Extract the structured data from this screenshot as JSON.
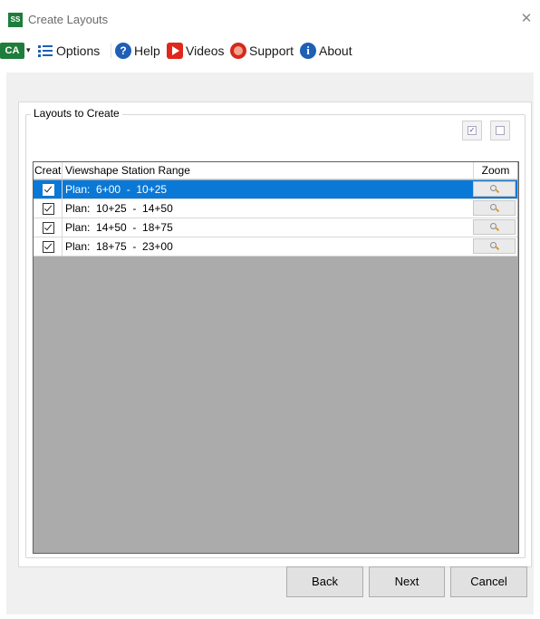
{
  "window": {
    "title": "Create Layouts",
    "app_logo_text": "SS",
    "close_glyph": "✕"
  },
  "toolbar": {
    "logo_text": "CA",
    "caret": "▾",
    "items": [
      {
        "label": "Options",
        "icon": "list-icon"
      },
      {
        "label": "Help",
        "icon": "help-icon"
      },
      {
        "label": "Videos",
        "icon": "video-icon"
      },
      {
        "label": "Support",
        "icon": "support-icon"
      },
      {
        "label": "About",
        "icon": "info-icon"
      }
    ]
  },
  "group": {
    "title": "Layouts to Create"
  },
  "grid": {
    "columns": {
      "create": "Create",
      "range": "Viewshape Station Range",
      "zoom": "Zoom"
    },
    "rows": [
      {
        "checked": true,
        "selected": true,
        "range": "Plan:  6+00  -  10+25"
      },
      {
        "checked": true,
        "selected": false,
        "range": "Plan:  10+25  -  14+50"
      },
      {
        "checked": true,
        "selected": false,
        "range": "Plan:  14+50  -  18+75"
      },
      {
        "checked": true,
        "selected": false,
        "range": "Plan:  18+75  -  23+00"
      }
    ]
  },
  "buttons": {
    "back": "Back",
    "next": "Next",
    "cancel": "Cancel"
  },
  "colors": {
    "selection": "#0a78d7",
    "grid_empty": "#ababab",
    "brand_green": "#1e7d3a"
  }
}
